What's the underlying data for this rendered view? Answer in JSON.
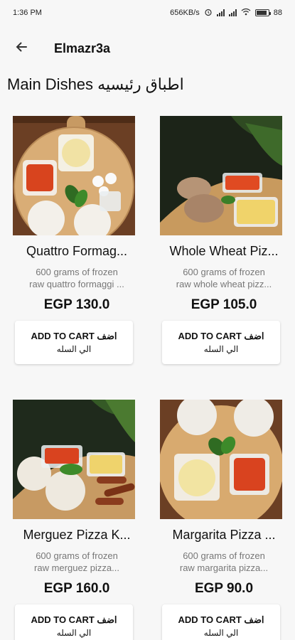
{
  "status_bar": {
    "time": "1:36 PM",
    "network_speed": "656KB/s",
    "battery": "88",
    "battery_level": 0.88
  },
  "app_bar": {
    "title": "Elmazr3a",
    "back_icon": "arrow-left-icon"
  },
  "section": {
    "title": "Main Dishes اطباق رئيسيه"
  },
  "products": [
    {
      "name": "Quattro Formag...",
      "desc_line1": "600 grams of frozen",
      "desc_line2": "raw quattro formaggi ...",
      "price": "EGP 130.0",
      "cart_line1": "ADD TO CART اضف",
      "cart_line2": "الي السله"
    },
    {
      "name": "Whole Wheat Piz...",
      "desc_line1": "600 grams of frozen",
      "desc_line2": "raw whole wheat pizz...",
      "price": "EGP 105.0",
      "cart_line1": "ADD TO CART اضف",
      "cart_line2": "الي السله"
    },
    {
      "name": "Merguez Pizza K...",
      "desc_line1": "600 grams of frozen",
      "desc_line2": "raw merguez pizza...",
      "price": "EGP 160.0",
      "cart_line1": "ADD TO CART اضف",
      "cart_line2": "الي السله"
    },
    {
      "name": "Margarita Pizza ...",
      "desc_line1": "600 grams of frozen",
      "desc_line2": "raw margarita pizza...",
      "price": "EGP 90.0",
      "cart_line1": "ADD TO CART اضف",
      "cart_line2": "الي السله"
    }
  ]
}
